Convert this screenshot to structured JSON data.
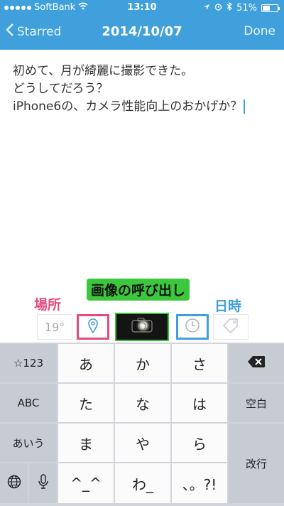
{
  "status_bar": {
    "carrier": "SoftBank",
    "time": "13:10",
    "battery": "51%",
    "battery_level": 0.51
  },
  "nav": {
    "back_label": "Starred",
    "title": "2014/10/07",
    "done_label": "Done"
  },
  "editor": {
    "lines": [
      "初めて、月が綺麗に撮影できた。",
      "どうしてだろう？",
      "iPhone6の、カメラ性能向上のおかげか？"
    ]
  },
  "annotations": {
    "callout": "画像の呼び出し",
    "place": "場所",
    "time": "日時"
  },
  "toolbar": {
    "weather": "19°",
    "icons": [
      "location-pin-icon",
      "camera-icon",
      "clock-icon",
      "tag-icon"
    ]
  },
  "keyboard": {
    "row1": [
      "☆123",
      "あ",
      "か",
      "さ"
    ],
    "row2": [
      "ABC",
      "た",
      "な",
      "は",
      "空白"
    ],
    "row3": [
      "あいう",
      "ま",
      "や",
      "ら"
    ],
    "row4": [
      "^_^",
      "わ_",
      "、。?!",
      "改行"
    ]
  },
  "colors": {
    "header": "#3fa0db",
    "location_highlight": "#e64a7d",
    "time_highlight": "#3fa0db",
    "photo_highlight": "#38c438"
  }
}
